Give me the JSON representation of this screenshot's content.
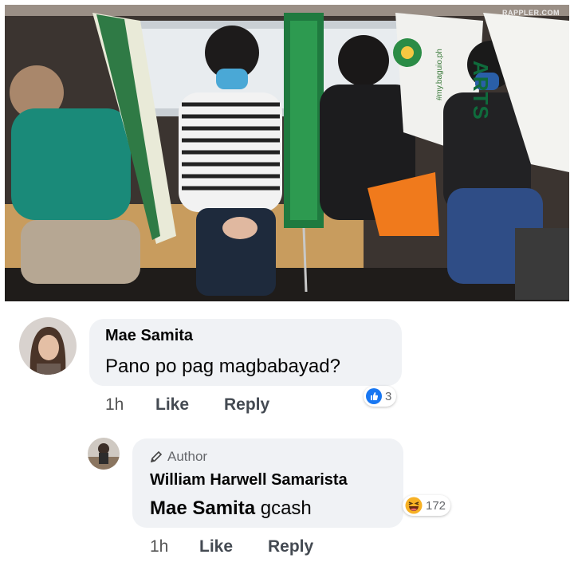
{
  "photo": {
    "credit": "RAPPLER.COM",
    "hashtag": "#my.baguio.ph",
    "banner_text": "ARTS"
  },
  "comments": [
    {
      "author": "Mae Samita",
      "text": "Pano po pag magbabayad?",
      "time": "1h",
      "like_label": "Like",
      "reply_label": "Reply",
      "reaction_icon": "thumbs-up-icon",
      "reaction_color": "#1877f2",
      "reaction_count": "3"
    }
  ],
  "reply": {
    "badge": "Author",
    "badge_icon": "pencil-icon",
    "author": "William Harwell Samarista",
    "mention": "Mae Samita",
    "text": "gcash",
    "time": "1h",
    "like_label": "Like",
    "reply_label": "Reply",
    "reaction_icon": "laughing-emoji-icon",
    "reaction_color": "#f7b125",
    "reaction_count": "172"
  }
}
